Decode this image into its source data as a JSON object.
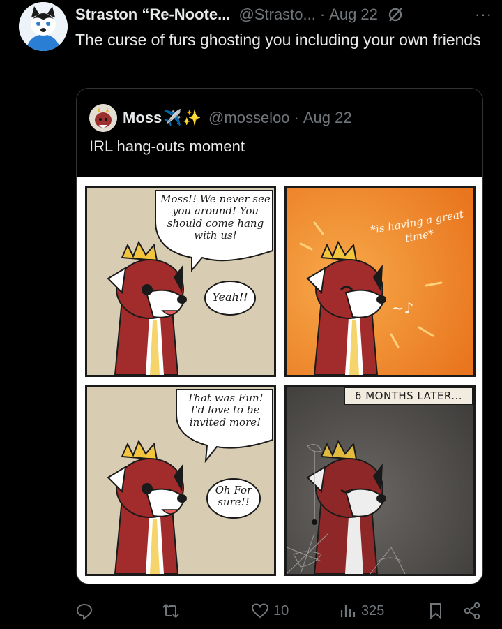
{
  "tweet": {
    "author_name": "Straston “Re-Noote...",
    "author_handle": "@Strasto...",
    "separator": "·",
    "date": "Aug 22",
    "more": "···",
    "text": "The curse of furs ghosting you including your own friends"
  },
  "quote": {
    "author_name": "Moss",
    "emoji": "✈️✨",
    "author_handle": "@mosseloo",
    "separator": "·",
    "date": "Aug 22",
    "text": "IRL hang-outs moment",
    "comic": {
      "panel1_bubble1": "Moss!! We never see you around! You should come hang with us!",
      "panel1_bubble2": "Yeah!!",
      "panel2_caption": "*is having a great time*",
      "panel3_bubble1": "That was Fun! I'd love to be invited more!",
      "panel3_bubble2": "Oh For sure!!",
      "panel4_caption": "6 MONTHS LATER..."
    }
  },
  "actions": {
    "reply_count": "",
    "retweet_count": "",
    "like_count": "10",
    "views_count": "325"
  }
}
